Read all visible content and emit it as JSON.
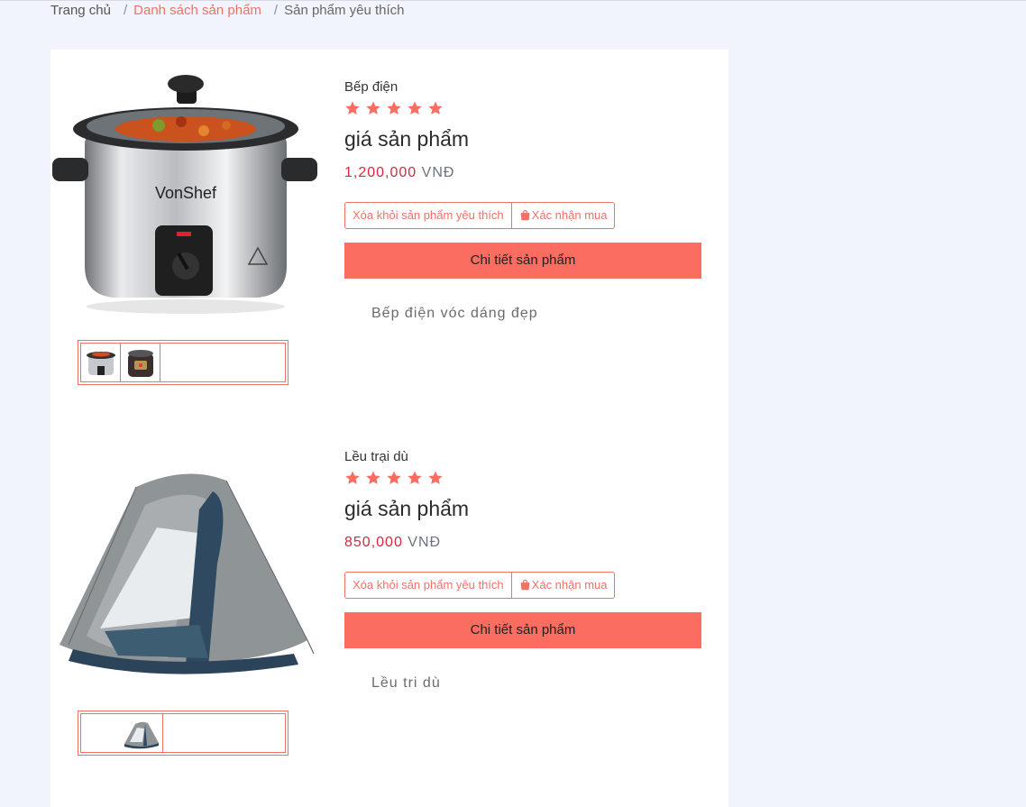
{
  "breadcrumb": {
    "home": "Trang chủ",
    "list": "Danh sách sản phẩm",
    "current": "Sản phẩm yêu thích"
  },
  "colors": {
    "accent": "#fb6d61",
    "price": "#d4283e",
    "background": "#f1f4fc"
  },
  "products": [
    {
      "name": "Bếp điện",
      "rating": 5,
      "price_label": "giá sản phẩm",
      "price": "1,200,000",
      "currency": "VNĐ",
      "remove_label": "Xóa khỏi sản phẩm yêu thích",
      "buy_label": "Xác nhận mua",
      "detail_label": "Chi tiết sản phẩm",
      "description": "Bếp điện vóc dáng đẹp"
    },
    {
      "name": "Lều trại dù",
      "rating": 5,
      "price_label": "giá sản phẩm",
      "price": "850,000",
      "currency": "VNĐ",
      "remove_label": "Xóa khỏi sản phẩm yêu thích",
      "buy_label": "Xác nhận mua",
      "detail_label": "Chi tiết sản phẩm",
      "description": "Lều tri dù"
    }
  ]
}
